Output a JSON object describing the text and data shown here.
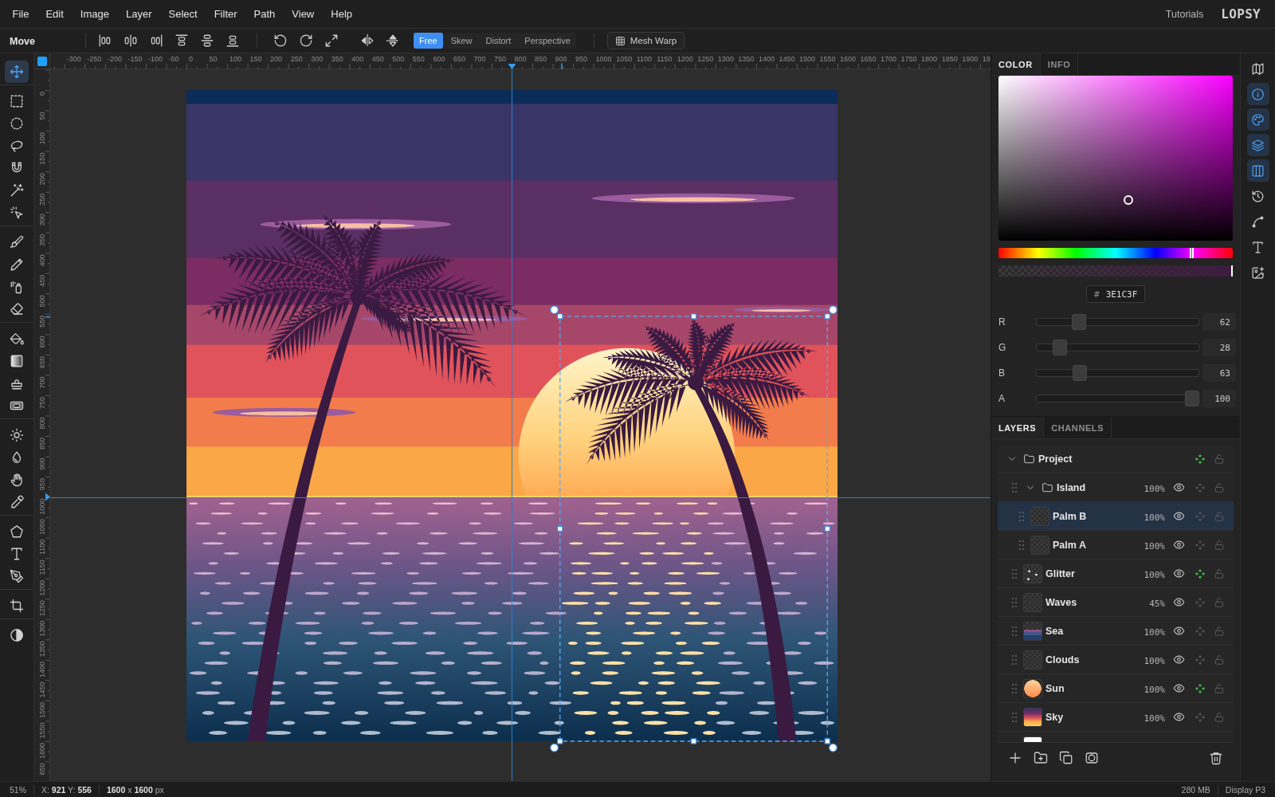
{
  "menu_bar": {
    "items": [
      "File",
      "Edit",
      "Image",
      "Layer",
      "Select",
      "Filter",
      "Path",
      "View",
      "Help"
    ],
    "tutorials_link": "Tutorials",
    "logo": "LOPSY"
  },
  "toolbar": {
    "tool_name": "Move",
    "button_groups": [
      {
        "buttons": [
          {
            "kind": "alignleft"
          },
          {
            "kind": "centerh"
          },
          {
            "kind": "alignright"
          },
          {
            "kind": "aligntop"
          },
          {
            "kind": "centerv"
          },
          {
            "kind": "alignbottom"
          }
        ]
      },
      {
        "buttons": [
          {
            "kind": "rotateleft"
          },
          {
            "kind": "rotateright"
          },
          {
            "kind": "fit"
          }
        ]
      },
      {
        "buttons": [
          {
            "kind": "fliph"
          },
          {
            "kind": "flipv"
          }
        ]
      }
    ],
    "transform_modes": [
      {
        "label": "Free",
        "selected": true
      },
      {
        "label": "Skew",
        "selected": false
      },
      {
        "label": "Distort",
        "selected": false
      },
      {
        "label": "Perspective",
        "selected": false
      }
    ],
    "mesh_warp_button": "Mesh Warp"
  },
  "tools": [
    {
      "tools": [
        {
          "kind": "move",
          "selected": true
        }
      ]
    },
    {
      "tools": [
        {
          "kind": "marquee",
          "selected": false
        },
        {
          "kind": "ellipse",
          "selected": false
        },
        {
          "kind": "lasso",
          "selected": false
        },
        {
          "kind": "magnet",
          "selected": false
        },
        {
          "kind": "wand",
          "selected": false
        },
        {
          "kind": "quickselect",
          "selected": false
        }
      ]
    },
    {
      "tools": [
        {
          "kind": "brush",
          "selected": false
        },
        {
          "kind": "pencil",
          "selected": false
        },
        {
          "kind": "spray",
          "selected": false
        },
        {
          "kind": "eraser",
          "selected": false
        }
      ]
    },
    {
      "tools": [
        {
          "kind": "bucket",
          "selected": false
        },
        {
          "kind": "gradient",
          "selected": false
        },
        {
          "kind": "stamp",
          "selected": false
        },
        {
          "kind": "patch",
          "selected": false
        }
      ]
    },
    {
      "tools": [
        {
          "kind": "dodge",
          "selected": false
        },
        {
          "kind": "blur",
          "selected": false
        },
        {
          "kind": "hand",
          "selected": false
        },
        {
          "kind": "eyedropper",
          "selected": false
        }
      ]
    },
    {
      "tools": [
        {
          "kind": "polygon",
          "selected": false
        },
        {
          "kind": "text",
          "selected": false
        },
        {
          "kind": "pen",
          "selected": false
        }
      ]
    },
    {
      "tools": [
        {
          "kind": "crop",
          "selected": false
        }
      ]
    },
    {
      "tools": [
        {
          "kind": "contrast",
          "selected": false
        }
      ]
    }
  ],
  "rulers": {
    "horizontal_labels": [
      "-300",
      "-250",
      "-200",
      "-150",
      "-100",
      "-50",
      "0",
      "50",
      "100",
      "150",
      "200",
      "250",
      "300",
      "350",
      "400",
      "450",
      "500",
      "550",
      "600",
      "650",
      "700",
      "750",
      "800",
      "850",
      "900",
      "950",
      "1000",
      "1050",
      "1100",
      "1150",
      "1200",
      "1250",
      "1300",
      "1350",
      "1400",
      "1450",
      "1500",
      "1550",
      "1600",
      "1650",
      "1700",
      "1750",
      "1800",
      "1850",
      "1900",
      "19"
    ],
    "vertical_labels": [
      "0",
      "50",
      "100",
      "150",
      "200",
      "250",
      "300",
      "350",
      "400",
      "450",
      "500",
      "550",
      "600",
      "650",
      "700",
      "750",
      "800",
      "850",
      "900",
      "950",
      "1000",
      "1050",
      "1100",
      "1150",
      "1200",
      "1250",
      "1300",
      "1350",
      "1400",
      "1450",
      "1500",
      "1550",
      "1600",
      "650"
    ]
  },
  "color_panel": {
    "tabs": [
      {
        "label": "COLOR",
        "selected": true
      },
      {
        "label": "INFO",
        "selected": false
      }
    ],
    "hue": {
      "level": 0.83
    },
    "alpha": {
      "level": 1
    },
    "hex": {
      "prefix": "#",
      "value": "3E1C3F"
    },
    "channels": [
      {
        "label": "R",
        "level": 0.243,
        "value": "62"
      },
      {
        "label": "G",
        "level": 0.11,
        "value": "28"
      },
      {
        "label": "B",
        "level": 0.247,
        "value": "63"
      },
      {
        "label": "A",
        "level": 1,
        "value": "100"
      }
    ]
  },
  "layers_panel": {
    "tabs": [
      {
        "label": "LAYERS",
        "selected": true
      },
      {
        "label": "CHANNELS",
        "selected": false
      }
    ],
    "layers": [
      {
        "kind": "folder",
        "name": "Project",
        "expanded": true,
        "effects": true,
        "locked": false,
        "selected": false,
        "children": [
          {
            "kind": "folder",
            "name": "Island",
            "opacity": "100%",
            "visible": true,
            "effects": false,
            "locked": false,
            "expanded": true,
            "selected": false,
            "children": [
              {
                "kind": "transparent",
                "name": "Palm B",
                "opacity": "100%",
                "visible": true,
                "effects": false,
                "locked": false,
                "selected": true
              },
              {
                "kind": "transparent",
                "name": "Palm A",
                "opacity": "100%",
                "visible": true,
                "effects": false,
                "locked": false,
                "selected": false
              }
            ]
          },
          {
            "kind": "sparkles",
            "name": "Glitter",
            "opacity": "100%",
            "visible": true,
            "effects": true,
            "locked": false,
            "selected": false
          },
          {
            "kind": "transparent",
            "name": "Waves",
            "opacity": "45%",
            "visible": true,
            "effects": false,
            "locked": false,
            "selected": false
          },
          {
            "kind": "sea",
            "name": "Sea",
            "opacity": "100%",
            "visible": true,
            "effects": false,
            "locked": false,
            "selected": false
          },
          {
            "kind": "transparent",
            "name": "Clouds",
            "opacity": "100%",
            "visible": true,
            "effects": false,
            "locked": false,
            "selected": false
          },
          {
            "kind": "sun",
            "name": "Sun",
            "opacity": "100%",
            "visible": true,
            "effects": true,
            "locked": false,
            "selected": false
          },
          {
            "kind": "sky",
            "name": "Sky",
            "opacity": "100%",
            "visible": true,
            "effects": false,
            "locked": false,
            "selected": false
          },
          {
            "kind": "blank",
            "selected": false
          }
        ]
      }
    ],
    "actions": [
      {
        "kind": "add"
      },
      {
        "kind": "group"
      },
      {
        "kind": "duplicate"
      },
      {
        "kind": "mask"
      },
      {
        "kind": "delete"
      }
    ]
  },
  "panel_toggles": [
    {
      "kind": "map",
      "on": false
    },
    {
      "kind": "info",
      "on": true
    },
    {
      "kind": "palette",
      "on": true
    },
    {
      "kind": "layers",
      "on": true
    },
    {
      "kind": "columns",
      "on": true
    },
    {
      "kind": "history",
      "on": false
    },
    {
      "kind": "curve",
      "on": false
    },
    {
      "kind": "text",
      "on": false
    },
    {
      "kind": "image",
      "on": false
    }
  ],
  "status_bar": {
    "zoom": "51%",
    "cursor": "X: **921** Y: **556**",
    "document_size": "**1600** x **1600** px",
    "memory": "280 MB",
    "color_profile": "Display P3"
  }
}
